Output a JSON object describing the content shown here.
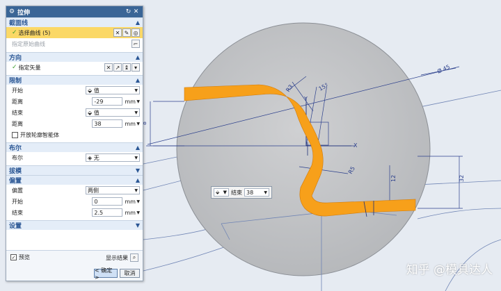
{
  "dialog": {
    "title": "拉伸",
    "section_curve": {
      "header": "截面线",
      "select_curve": "选择曲线 (5)",
      "specify_origin_curve": "指定原始曲线"
    },
    "section_direction": {
      "header": "方向",
      "specify_vector": "指定矢量"
    },
    "section_limits": {
      "header": "限制",
      "start_label": "开始",
      "start_value": "值",
      "start_dist_label": "距离",
      "start_dist_value": "-29",
      "start_unit": "mm",
      "end_label": "结束",
      "end_value": "值",
      "end_dist_label": "距离",
      "end_dist_value": "38",
      "end_unit": "mm",
      "open_profile": "开放轮廓智能体"
    },
    "section_boolean": {
      "header": "布尔",
      "label": "布尔",
      "value": "无"
    },
    "section_draft": {
      "header": "拔模"
    },
    "section_offset": {
      "header": "偏置",
      "offset_label": "偏置",
      "offset_value": "两侧",
      "start_label": "开始",
      "start_value": "0",
      "start_unit": "mm",
      "end_label": "结束",
      "end_value": "2.5",
      "end_unit": "mm"
    },
    "section_settings": {
      "header": "设置"
    },
    "preview_label": "预览",
    "show_result_label": "显示结果",
    "ok_label": "< 确定 >",
    "cancel_label": "取消"
  },
  "float_input": {
    "label": "结束",
    "value": "38"
  },
  "dimensions": {
    "left_8": "8",
    "right_32": "32",
    "d_phi": "Ø 45",
    "r_a": "R3",
    "r_b": "R5",
    "r_c": "12",
    "r_d": "15°"
  },
  "axis": {
    "x_label": "X",
    "y_label": "Y"
  },
  "watermark": "知乎 @模具达人",
  "colors": {
    "title_bar": "#3a6596",
    "section_header_bg": "#e4edf8",
    "selected_row": "#fbd866",
    "part_orange": "#f7a01a",
    "sphere": "#c5c6c8"
  }
}
